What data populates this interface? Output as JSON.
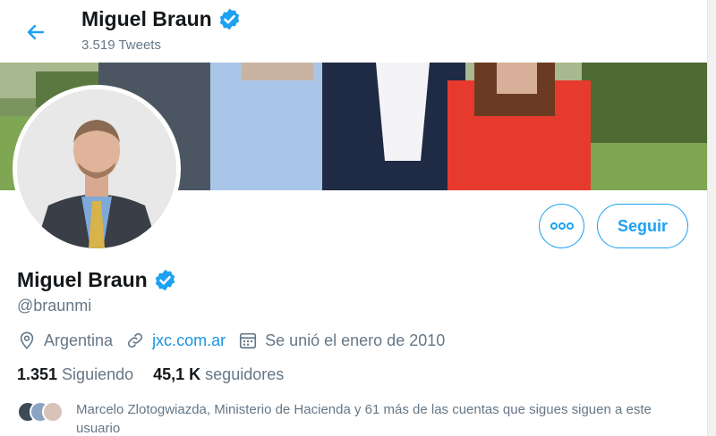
{
  "header": {
    "name": "Miguel Braun",
    "tweet_count": "3.519 Tweets"
  },
  "profile": {
    "name": "Miguel Braun",
    "handle": "@braunmi",
    "location": "Argentina",
    "website": "jxc.com.ar",
    "joined": "Se unió el enero de 2010"
  },
  "actions": {
    "more_label": "•••",
    "follow_label": "Seguir"
  },
  "stats": {
    "following_count": "1.351",
    "following_label": "Siguiendo",
    "followers_count": "45,1 K",
    "followers_label": "seguidores"
  },
  "known_followers": {
    "text": "Marcelo Zlotogwiazda, Ministerio de Hacienda y 61 más de las cuentas que sigues siguen a este usuario"
  },
  "colors": {
    "accent": "#1da1f2",
    "secondary_text": "#657786",
    "link": "#1b95e0",
    "verified": "#1da1f2"
  },
  "icons": [
    "back-arrow-icon",
    "verified-badge-icon",
    "location-icon",
    "link-icon",
    "calendar-icon",
    "more-icon"
  ]
}
